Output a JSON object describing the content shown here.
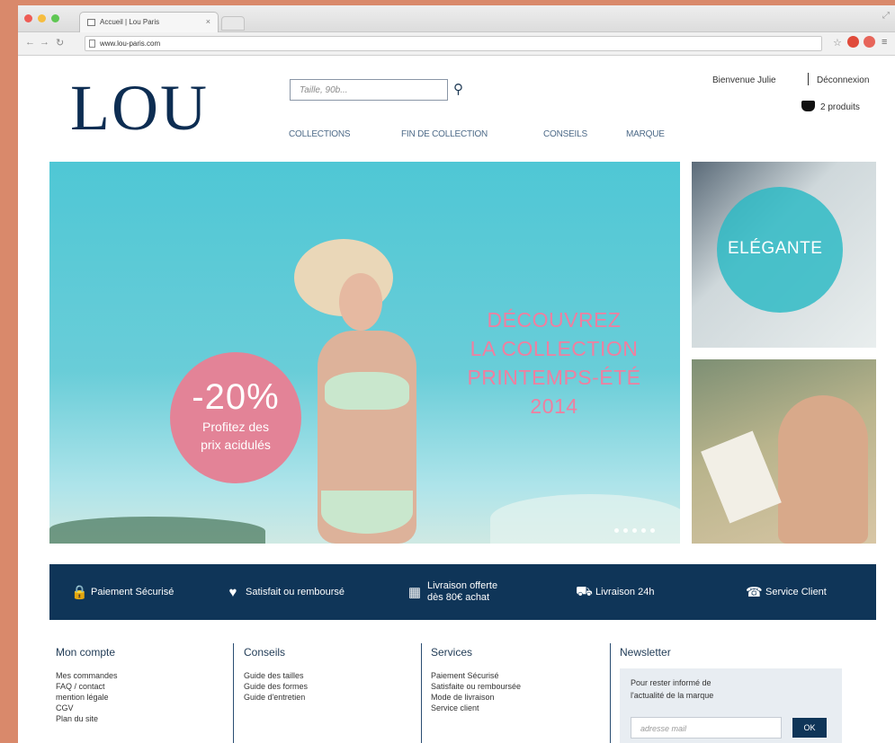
{
  "browser": {
    "tab_title": "Accueil | Lou Paris",
    "tab_close": "×",
    "url": "www.lou-paris.com",
    "traffic_colors": [
      "#ee5c55",
      "#f6bd3f",
      "#5fc753"
    ]
  },
  "header": {
    "logo": "LOU",
    "search_placeholder": "Taille, 90b...",
    "search_icon": "magnifier-icon",
    "nav": [
      "COLLECTIONS",
      "FIN DE COLLECTION",
      "CONSEILS",
      "MARQUE"
    ],
    "welcome": "Bienvenue Julie",
    "logout": "Déconnexion",
    "cart": "2 produits"
  },
  "hero": {
    "badge_pct": "-20%",
    "badge_line1": "Profitez des",
    "badge_line2": "prix acidulés",
    "headline": [
      "DÉCOUVREZ",
      "LA COLLECTION",
      "PRINTEMPS-ÉTÉ",
      "2014"
    ],
    "slide_count": 5
  },
  "side_banner": {
    "label": "ELÉGANTE"
  },
  "features": [
    {
      "icon": "lock-icon",
      "glyph": "🔒",
      "line1": "Paiement Sécurisé",
      "line2": ""
    },
    {
      "icon": "heart-icon",
      "glyph": "♥",
      "line1": "Satisfait ou remboursé",
      "line2": ""
    },
    {
      "icon": "gift-icon",
      "glyph": "▦",
      "line1": "Livraison offerte",
      "line2": "dès 80€ achat"
    },
    {
      "icon": "package-icon",
      "glyph": "⛟",
      "line1": "Livraison 24h",
      "line2": ""
    },
    {
      "icon": "headset-icon",
      "glyph": "☎",
      "line1": "Service Client",
      "line2": ""
    }
  ],
  "footer": {
    "account": {
      "title": "Mon compte",
      "items": [
        "Mes commandes",
        "FAQ / contact",
        "mention légale",
        "CGV",
        "Plan du site"
      ]
    },
    "advice": {
      "title": "Conseils",
      "items": [
        "Guide des tailles",
        "Guide des formes",
        "Guide d'entretien"
      ]
    },
    "services": {
      "title": "Services",
      "items": [
        "Paiement Sécurisé",
        "Satisfaite ou remboursée",
        "Mode de livraison",
        "Service client"
      ]
    },
    "newsletter": {
      "title": "Newsletter",
      "text1": "Pour rester informé de",
      "text2": "l'actualité de la marque",
      "placeholder": "adresse mail",
      "button": "OK"
    }
  },
  "colors": {
    "navy": "#0f3558",
    "pink": "#e38397",
    "hero_text": "#ef7fa0",
    "turquoise": "#4fc7d5",
    "page_bg": "#d9896b"
  }
}
